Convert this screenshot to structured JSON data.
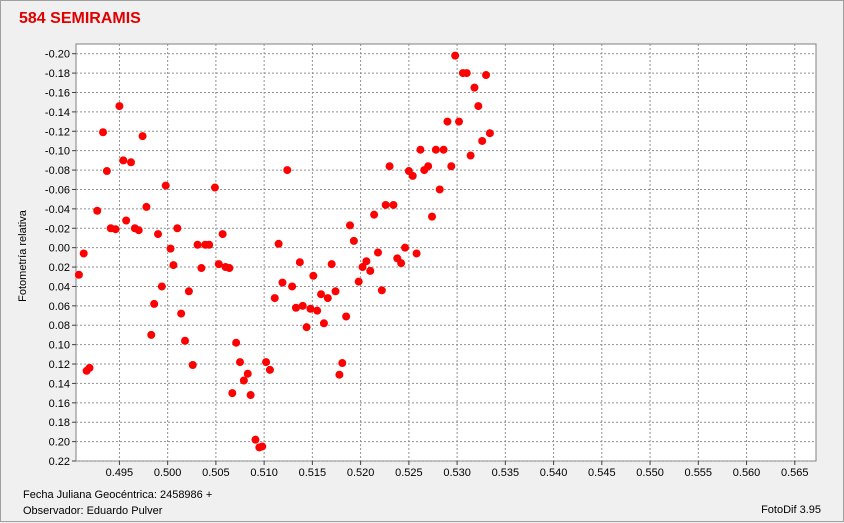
{
  "chart_data": {
    "type": "scatter",
    "title": "584 SEMIRAMIS",
    "ylabel": "Fotometría relativa",
    "xlim": [
      0.4905,
      0.5672
    ],
    "ylim": [
      -0.21,
      0.22
    ],
    "y_inverted": true,
    "grid": true,
    "x_ticks": [
      0.495,
      0.5,
      0.505,
      0.51,
      0.515,
      0.52,
      0.525,
      0.53,
      0.535,
      0.54,
      0.545,
      0.55,
      0.555,
      0.56,
      0.565
    ],
    "x_tick_labels": [
      "0.495",
      "0.500",
      "0.505",
      "0.510",
      "0.515",
      "0.520",
      "0.525",
      "0.530",
      "0.535",
      "0.540",
      "0.545",
      "0.550",
      "0.555",
      "0.560",
      "0.565"
    ],
    "y_ticks": [
      -0.2,
      -0.18,
      -0.16,
      -0.14,
      -0.12,
      -0.1,
      -0.08,
      -0.06,
      -0.04,
      -0.02,
      0.0,
      0.02,
      0.04,
      0.06,
      0.08,
      0.1,
      0.12,
      0.14,
      0.16,
      0.18,
      0.2,
      0.22
    ],
    "y_tick_labels": [
      "-0.20",
      "-0.18",
      "-0.16",
      "-0.14",
      "-0.12",
      "-0.10",
      "-0.08",
      "-0.06",
      "-0.04",
      "-0.02",
      "0.00",
      "0.02",
      "0.04",
      "0.06",
      "0.08",
      "0.10",
      "0.12",
      "0.14",
      "0.16",
      "0.18",
      "0.20",
      "0.22"
    ],
    "marker_color": "#ff0000",
    "points": [
      [
        0.4908,
        0.028
      ],
      [
        0.4913,
        0.006
      ],
      [
        0.4916,
        0.127
      ],
      [
        0.4919,
        0.124
      ],
      [
        0.4927,
        -0.038
      ],
      [
        0.4933,
        -0.119
      ],
      [
        0.4937,
        -0.079
      ],
      [
        0.4941,
        -0.02
      ],
      [
        0.4946,
        -0.019
      ],
      [
        0.495,
        -0.146
      ],
      [
        0.4954,
        -0.09
      ],
      [
        0.4957,
        -0.028
      ],
      [
        0.4962,
        -0.088
      ],
      [
        0.4966,
        -0.02
      ],
      [
        0.497,
        -0.018
      ],
      [
        0.4974,
        -0.115
      ],
      [
        0.4978,
        -0.042
      ],
      [
        0.4983,
        0.09
      ],
      [
        0.4986,
        0.058
      ],
      [
        0.499,
        -0.014
      ],
      [
        0.4994,
        0.04
      ],
      [
        0.4998,
        -0.064
      ],
      [
        0.5003,
        0.001
      ],
      [
        0.5006,
        0.018
      ],
      [
        0.501,
        -0.02
      ],
      [
        0.5014,
        0.068
      ],
      [
        0.5018,
        0.096
      ],
      [
        0.5022,
        0.045
      ],
      [
        0.5026,
        0.121
      ],
      [
        0.5031,
        -0.003
      ],
      [
        0.5035,
        0.021
      ],
      [
        0.5039,
        -0.003
      ],
      [
        0.5043,
        -0.003
      ],
      [
        0.5049,
        -0.062
      ],
      [
        0.5053,
        0.017
      ],
      [
        0.5057,
        -0.014
      ],
      [
        0.506,
        0.02
      ],
      [
        0.5064,
        0.021
      ],
      [
        0.5067,
        0.15
      ],
      [
        0.5071,
        0.098
      ],
      [
        0.5075,
        0.118
      ],
      [
        0.5079,
        0.137
      ],
      [
        0.5083,
        0.13
      ],
      [
        0.5086,
        0.152
      ],
      [
        0.5091,
        0.198
      ],
      [
        0.5095,
        0.206
      ],
      [
        0.5098,
        0.205
      ],
      [
        0.5102,
        0.118
      ],
      [
        0.5106,
        0.126
      ],
      [
        0.5111,
        0.052
      ],
      [
        0.5115,
        -0.004
      ],
      [
        0.5119,
        0.036
      ],
      [
        0.5124,
        -0.08
      ],
      [
        0.5129,
        0.04
      ],
      [
        0.5133,
        0.062
      ],
      [
        0.5137,
        0.015
      ],
      [
        0.514,
        0.06
      ],
      [
        0.5144,
        0.082
      ],
      [
        0.5148,
        0.063
      ],
      [
        0.5151,
        0.029
      ],
      [
        0.5155,
        0.065
      ],
      [
        0.5159,
        0.048
      ],
      [
        0.5162,
        0.078
      ],
      [
        0.5166,
        0.052
      ],
      [
        0.517,
        0.017
      ],
      [
        0.5174,
        0.045
      ],
      [
        0.5178,
        0.131
      ],
      [
        0.5181,
        0.119
      ],
      [
        0.5185,
        0.071
      ],
      [
        0.5189,
        -0.023
      ],
      [
        0.5193,
        -0.007
      ],
      [
        0.5198,
        0.035
      ],
      [
        0.5202,
        0.02
      ],
      [
        0.5206,
        0.014
      ],
      [
        0.521,
        0.024
      ],
      [
        0.5214,
        -0.034
      ],
      [
        0.5218,
        0.005
      ],
      [
        0.5222,
        0.044
      ],
      [
        0.5226,
        -0.044
      ],
      [
        0.523,
        -0.084
      ],
      [
        0.5234,
        -0.044
      ],
      [
        0.5238,
        0.011
      ],
      [
        0.5242,
        0.016
      ],
      [
        0.5246,
        0.0
      ],
      [
        0.525,
        -0.079
      ],
      [
        0.5254,
        -0.074
      ],
      [
        0.5258,
        0.006
      ],
      [
        0.5262,
        -0.101
      ],
      [
        0.5266,
        -0.08
      ],
      [
        0.527,
        -0.084
      ],
      [
        0.5274,
        -0.032
      ],
      [
        0.5278,
        -0.101
      ],
      [
        0.5282,
        -0.06
      ],
      [
        0.5286,
        -0.101
      ],
      [
        0.529,
        -0.13
      ],
      [
        0.5294,
        -0.084
      ],
      [
        0.5298,
        -0.198
      ],
      [
        0.5302,
        -0.13
      ],
      [
        0.5306,
        -0.18
      ],
      [
        0.531,
        -0.18
      ],
      [
        0.5314,
        -0.095
      ],
      [
        0.5318,
        -0.165
      ],
      [
        0.5322,
        -0.146
      ],
      [
        0.5326,
        -0.11
      ],
      [
        0.533,
        -0.178
      ],
      [
        0.5334,
        -0.118
      ]
    ]
  },
  "footer": {
    "date_label": "Fecha Juliana Geocéntrica: 2458986 +",
    "observer_label": "Observador: Eduardo Pulver",
    "software_label": "FotoDif 3.95"
  }
}
